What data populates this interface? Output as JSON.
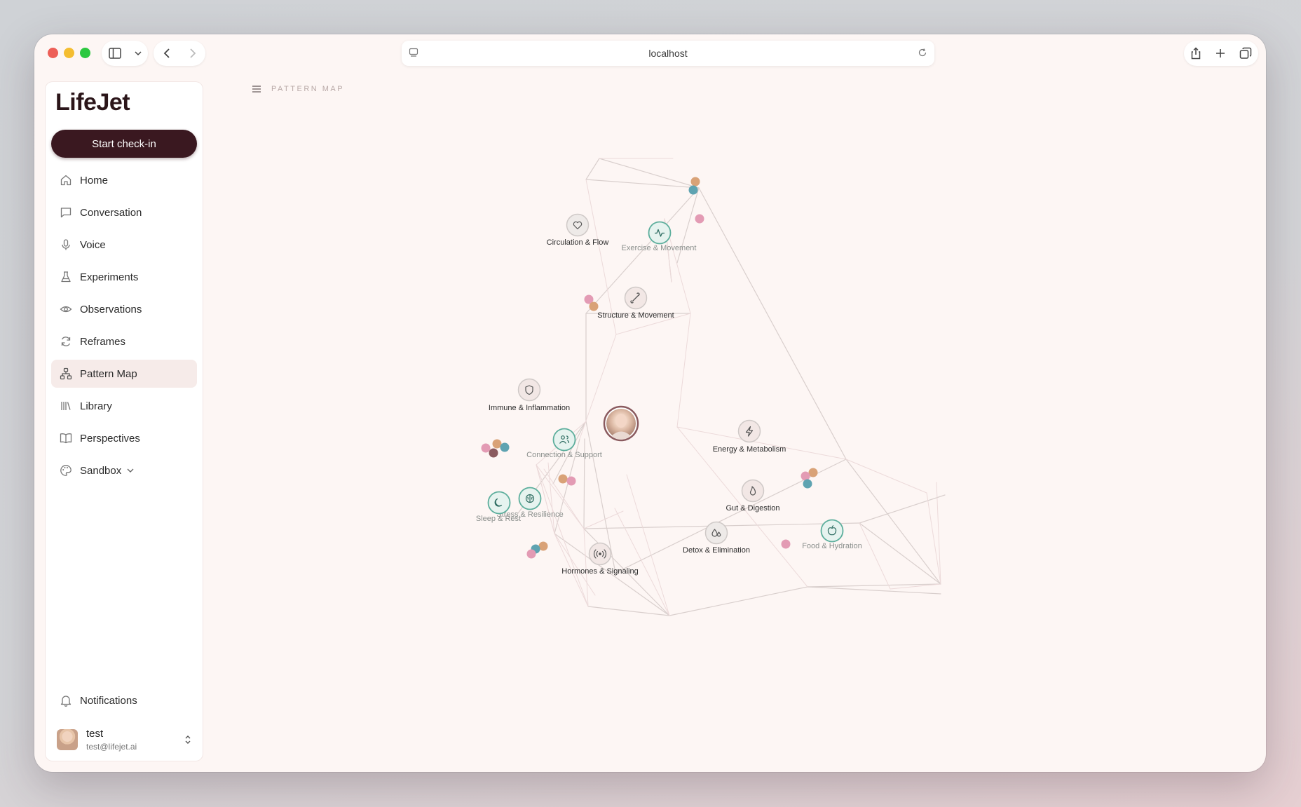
{
  "browser": {
    "url": "localhost"
  },
  "sidebar": {
    "logo": "LifeJet",
    "start_button": "Start check-in",
    "items": [
      {
        "label": "Home",
        "icon": "home-icon"
      },
      {
        "label": "Conversation",
        "icon": "chat-icon"
      },
      {
        "label": "Voice",
        "icon": "mic-icon"
      },
      {
        "label": "Experiments",
        "icon": "flask-icon"
      },
      {
        "label": "Observations",
        "icon": "eye-icon"
      },
      {
        "label": "Reframes",
        "icon": "refresh-icon"
      },
      {
        "label": "Pattern Map",
        "icon": "network-icon",
        "active": true
      },
      {
        "label": "Library",
        "icon": "library-icon"
      },
      {
        "label": "Perspectives",
        "icon": "book-icon"
      },
      {
        "label": "Sandbox",
        "icon": "palette-icon",
        "expandable": true
      }
    ],
    "notifications": "Notifications",
    "user": {
      "name": "test",
      "email": "test@lifejet.ai"
    }
  },
  "main": {
    "breadcrumb": "PATTERN MAP",
    "nodes": [
      {
        "id": "circulation",
        "label": "Circulation & Flow",
        "icon": "heart-icon",
        "style": "neutral"
      },
      {
        "id": "exercise",
        "label": "Exercise & Movement",
        "icon": "pulse-icon",
        "style": "green"
      },
      {
        "id": "structure",
        "label": "Structure & Movement",
        "icon": "bone-icon",
        "style": "neutral"
      },
      {
        "id": "immune",
        "label": "Immune & Inflammation",
        "icon": "shield-icon",
        "style": "neutral"
      },
      {
        "id": "connection",
        "label": "Connection & Support",
        "icon": "people-icon",
        "style": "green"
      },
      {
        "id": "energy",
        "label": "Energy & Metabolism",
        "icon": "bolt-icon",
        "style": "neutral"
      },
      {
        "id": "gut",
        "label": "Gut & Digestion",
        "icon": "flame-icon",
        "style": "neutral"
      },
      {
        "id": "sleep",
        "label": "Sleep & Rest",
        "icon": "moon-icon",
        "style": "green"
      },
      {
        "id": "stress",
        "label": "Stress & Resilience",
        "icon": "brain-icon",
        "style": "green"
      },
      {
        "id": "detox",
        "label": "Detox & Elimination",
        "icon": "drops-icon",
        "style": "neutral"
      },
      {
        "id": "food",
        "label": "Food & Hydration",
        "icon": "apple-icon",
        "style": "green"
      },
      {
        "id": "hormones",
        "label": "Hormones & Signaling",
        "icon": "signal-icon",
        "style": "neutral"
      }
    ],
    "center_avatar": "user-avatar"
  },
  "colors": {
    "accent": "#3a1820",
    "green_node": "#5cae9c",
    "dot_pink": "#e39bb4",
    "dot_orange": "#d9a277",
    "dot_teal": "#5ea3b1",
    "dot_brown": "#8a5a5e"
  }
}
